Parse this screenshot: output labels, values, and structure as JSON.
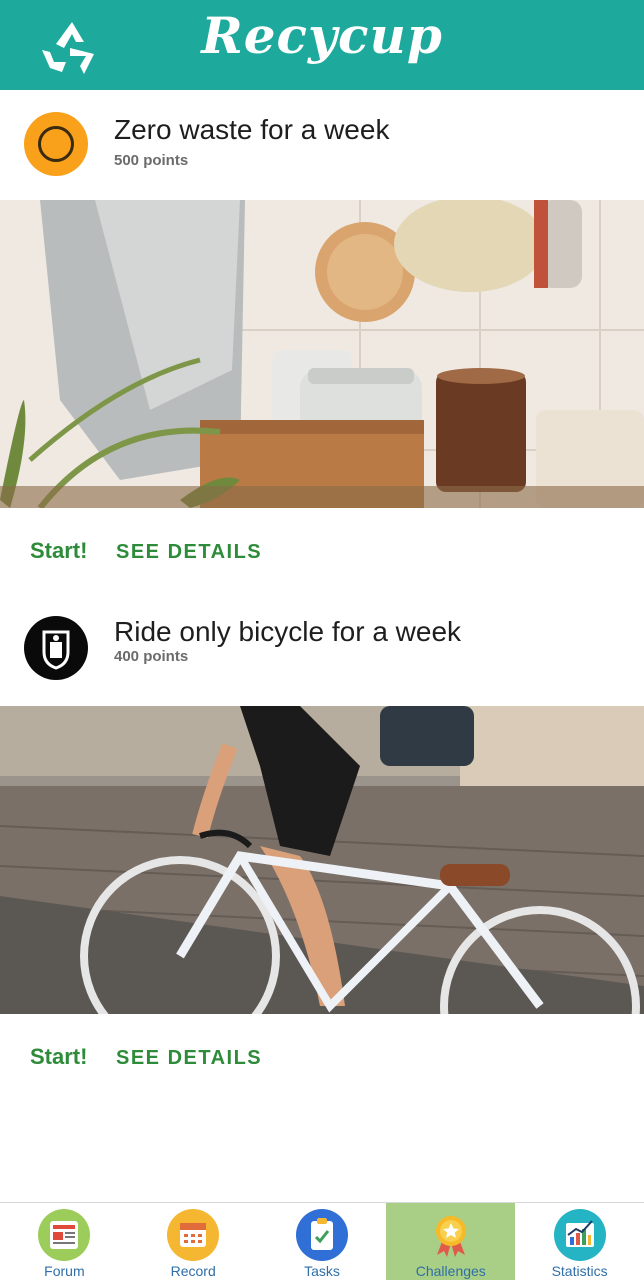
{
  "app": {
    "title": "Recycup"
  },
  "challenges": [
    {
      "title": "Zero waste for a week",
      "points": "500 points",
      "start_label": "Start!",
      "details_label": "SEE DETAILS"
    },
    {
      "title": "Ride only bicycle for a week",
      "points": "400 points",
      "start_label": "Start!",
      "details_label": "SEE DETAILS"
    }
  ],
  "nav": {
    "items": [
      {
        "label": "Forum",
        "icon": "news-icon"
      },
      {
        "label": "Record",
        "icon": "calendar-icon"
      },
      {
        "label": "Tasks",
        "icon": "clipboard-icon"
      },
      {
        "label": "Challenges",
        "icon": "medal-icon",
        "active": true
      },
      {
        "label": "Statistics",
        "icon": "chart-icon"
      }
    ]
  },
  "colors": {
    "header": "#1daa9c",
    "accent_green": "#2e8b3a",
    "active_tab": "#a9cf86",
    "nav_label": "#2f6ea8"
  }
}
